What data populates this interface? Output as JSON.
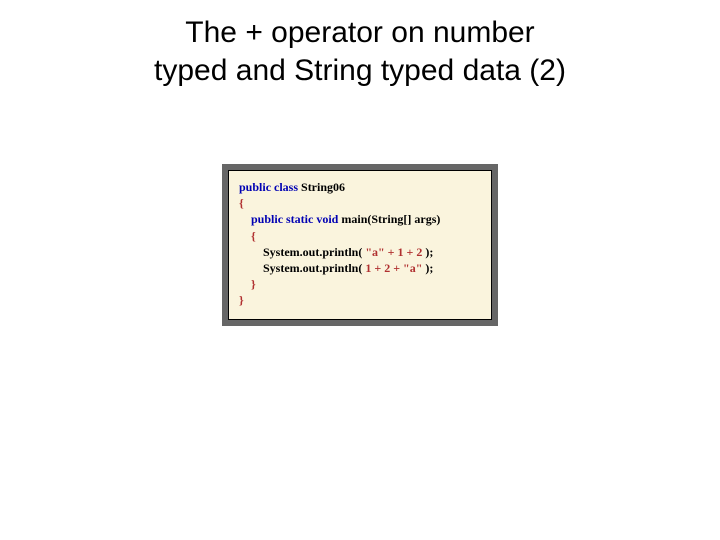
{
  "title_line1": "The + operator on number",
  "title_line2": "typed and String typed data (2)",
  "code": {
    "kw_public": "public",
    "kw_class": "class",
    "kw_static": "static",
    "kw_void": "void",
    "cls_name": "String06",
    "main_name": "main",
    "main_params": "(String[] args)",
    "brace_open": "{",
    "brace_close": "}",
    "indent1": "    ",
    "indent2": "        ",
    "stmt_call": "System.out.println(",
    "space": " ",
    "str_a": "\"a\"",
    "plus": "+",
    "num_1": "1",
    "num_2": "2",
    "stmt_end": ");"
  }
}
